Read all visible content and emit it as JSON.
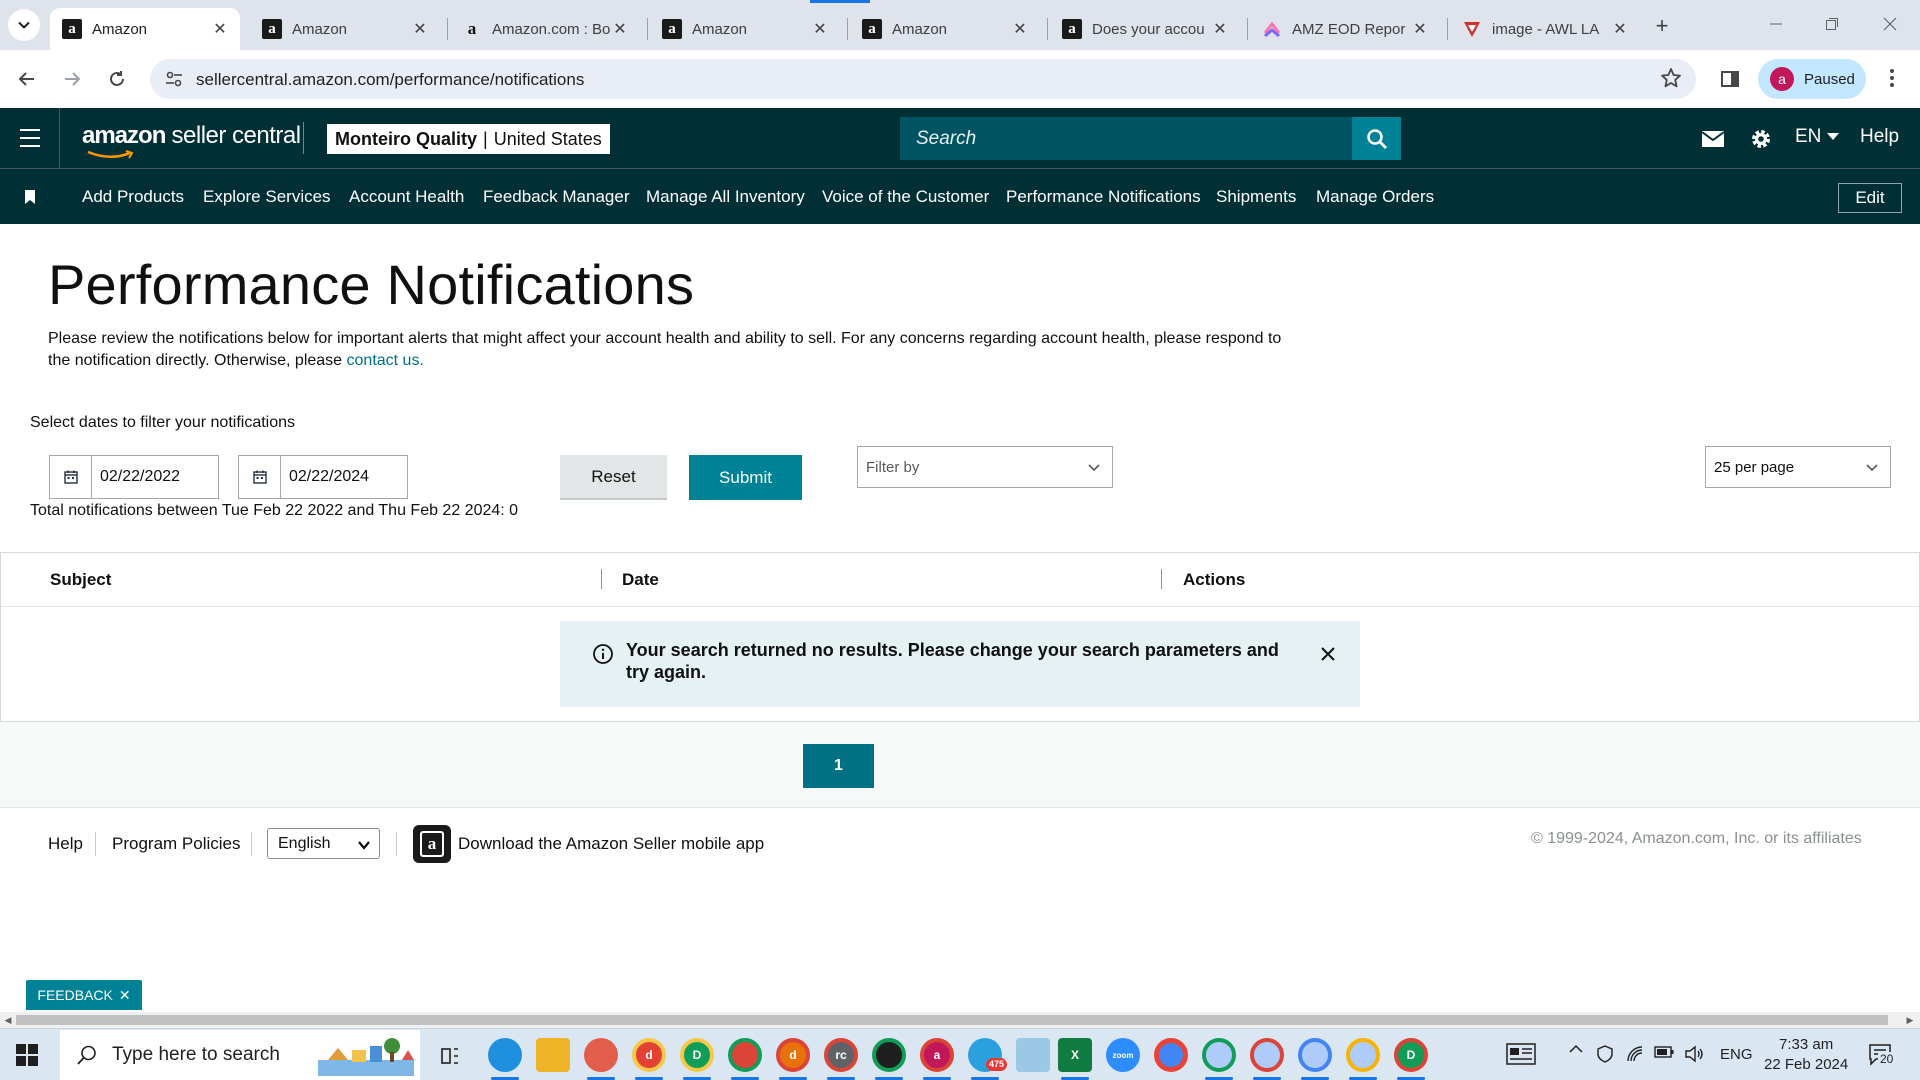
{
  "browser": {
    "tabs": [
      {
        "title": "Amazon",
        "favicon": "amazon-icon",
        "active": true
      },
      {
        "title": "Amazon",
        "favicon": "amazon-icon"
      },
      {
        "title": "Amazon.com : Bo",
        "favicon": "amazon-smile-icon"
      },
      {
        "title": "Amazon",
        "favicon": "amazon-icon"
      },
      {
        "title": "Amazon",
        "favicon": "amazon-icon"
      },
      {
        "title": "Does your accou",
        "favicon": "amazon-icon"
      },
      {
        "title": "AMZ EOD Repor",
        "favicon": "clickup-icon"
      },
      {
        "title": "image - AWL LA",
        "favicon": "vivaldi-icon"
      }
    ],
    "close_glyph": "✕",
    "new_tab_glyph": "+",
    "url": "sellercentral.amazon.com/performance/notifications",
    "profile_initial": "a",
    "profile_label": "Paused"
  },
  "header": {
    "logo_bold": "amazon",
    "logo_rest": " seller central",
    "store_name": "Monteiro Quality",
    "store_divider": "|",
    "store_region": "United States",
    "search_placeholder": "Search",
    "language": "EN",
    "help": "Help"
  },
  "bookmarks": {
    "items": [
      "Add Products",
      "Explore Services",
      "Account Health",
      "Feedback Manager",
      "Manage All Inventory",
      "Voice of the Customer",
      "Performance Notifications",
      "Shipments",
      "Manage Orders"
    ],
    "edit_label": "Edit"
  },
  "page": {
    "title": "Performance Notifications",
    "description": "Please review the notifications below for important alerts that might affect your account health and ability to sell. For any concerns regarding account health, please respond to the notification directly. Otherwise, please ",
    "contact_link": "contact us.",
    "filter_label": "Select dates to filter your notifications",
    "start_date": "02/22/2022",
    "end_date": "02/22/2024",
    "reset_label": "Reset",
    "submit_label": "Submit",
    "filter_placeholder": "Filter by",
    "per_page": "25 per page",
    "total_text": "Total notifications between Tue Feb 22 2022 and Thu Feb 22 2024: 0"
  },
  "table": {
    "columns": [
      "Subject",
      "Date",
      "Actions"
    ],
    "empty_message": "Your search returned no results. Please change your search parameters and try again."
  },
  "pagination": {
    "current_page": "1"
  },
  "footer": {
    "help": "Help",
    "program_policies": "Program Policies",
    "language": "English",
    "app_text": "Download the Amazon Seller mobile app",
    "copyright": "© 1999-2024, Amazon.com, Inc. or its affiliates"
  },
  "feedback": {
    "label": "FEEDBACK",
    "close_glyph": "✕"
  },
  "taskbar": {
    "search_placeholder": "Type here to search",
    "telegram_badge": "475",
    "language": "ENG",
    "time": "7:33 am",
    "date": "22 Feb 2024",
    "notification_count": "20"
  },
  "colors": {
    "header_bg": "#002f36",
    "search_bg": "#005461",
    "accent": "#008296",
    "link": "#007185",
    "alert_bg": "#e5f1f2"
  }
}
